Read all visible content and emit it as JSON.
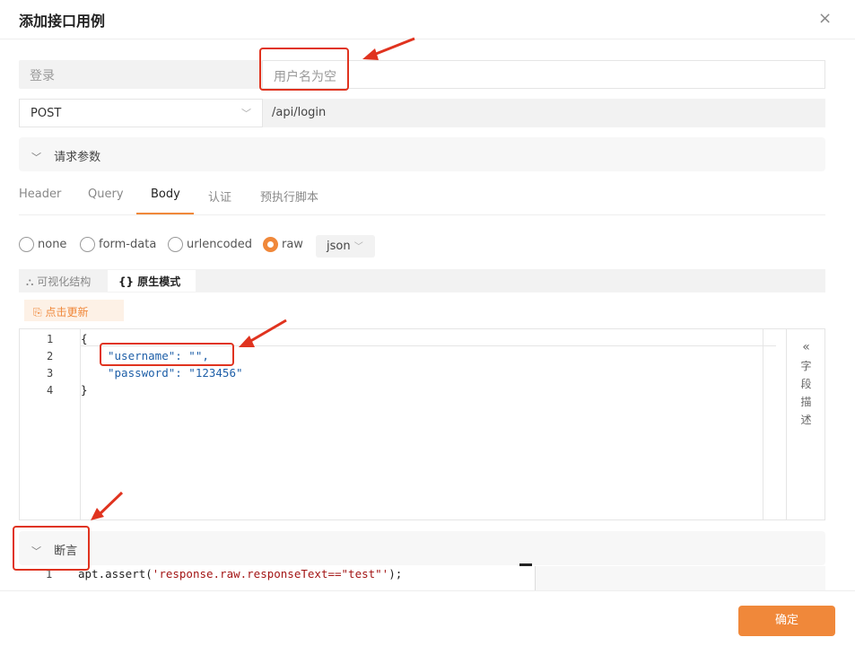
{
  "dialog": {
    "title": "添加接口用例",
    "close_icon": "×"
  },
  "form": {
    "group_name": "登录",
    "case_name_placeholder": "用户名为空",
    "method": "POST",
    "url": "/api/login"
  },
  "request_section": {
    "label": "请求参数"
  },
  "tabs": [
    {
      "label": "Header"
    },
    {
      "label": "Query"
    },
    {
      "label": "Body",
      "active": true
    },
    {
      "label": "认证"
    },
    {
      "label": "预执行脚本"
    }
  ],
  "body_types": [
    {
      "label": "none",
      "checked": false
    },
    {
      "label": "form-data",
      "checked": false
    },
    {
      "label": "urlencoded",
      "checked": false
    },
    {
      "label": "raw",
      "checked": true
    }
  ],
  "raw_format": "json",
  "modes": {
    "visual": "可视化结构",
    "raw_mode": "原生模式"
  },
  "refresh_label": "点击更新",
  "editor": {
    "line_numbers": [
      "1",
      "2",
      "3",
      "4"
    ],
    "lines": [
      "{",
      "\"username\": \"\",",
      "\"password\": \"123456\"",
      "}"
    ],
    "field_panel": {
      "arrow": "«",
      "chars": [
        "字",
        "段",
        "描",
        "述"
      ]
    }
  },
  "assert_section": {
    "label": "断言",
    "line_number": "1",
    "code": "apt.assert('response.raw.responseText==\"test\"');"
  },
  "footer": {
    "confirm": "确定"
  },
  "colors": {
    "accent": "#f0883a",
    "annotation": "#e0331f"
  }
}
